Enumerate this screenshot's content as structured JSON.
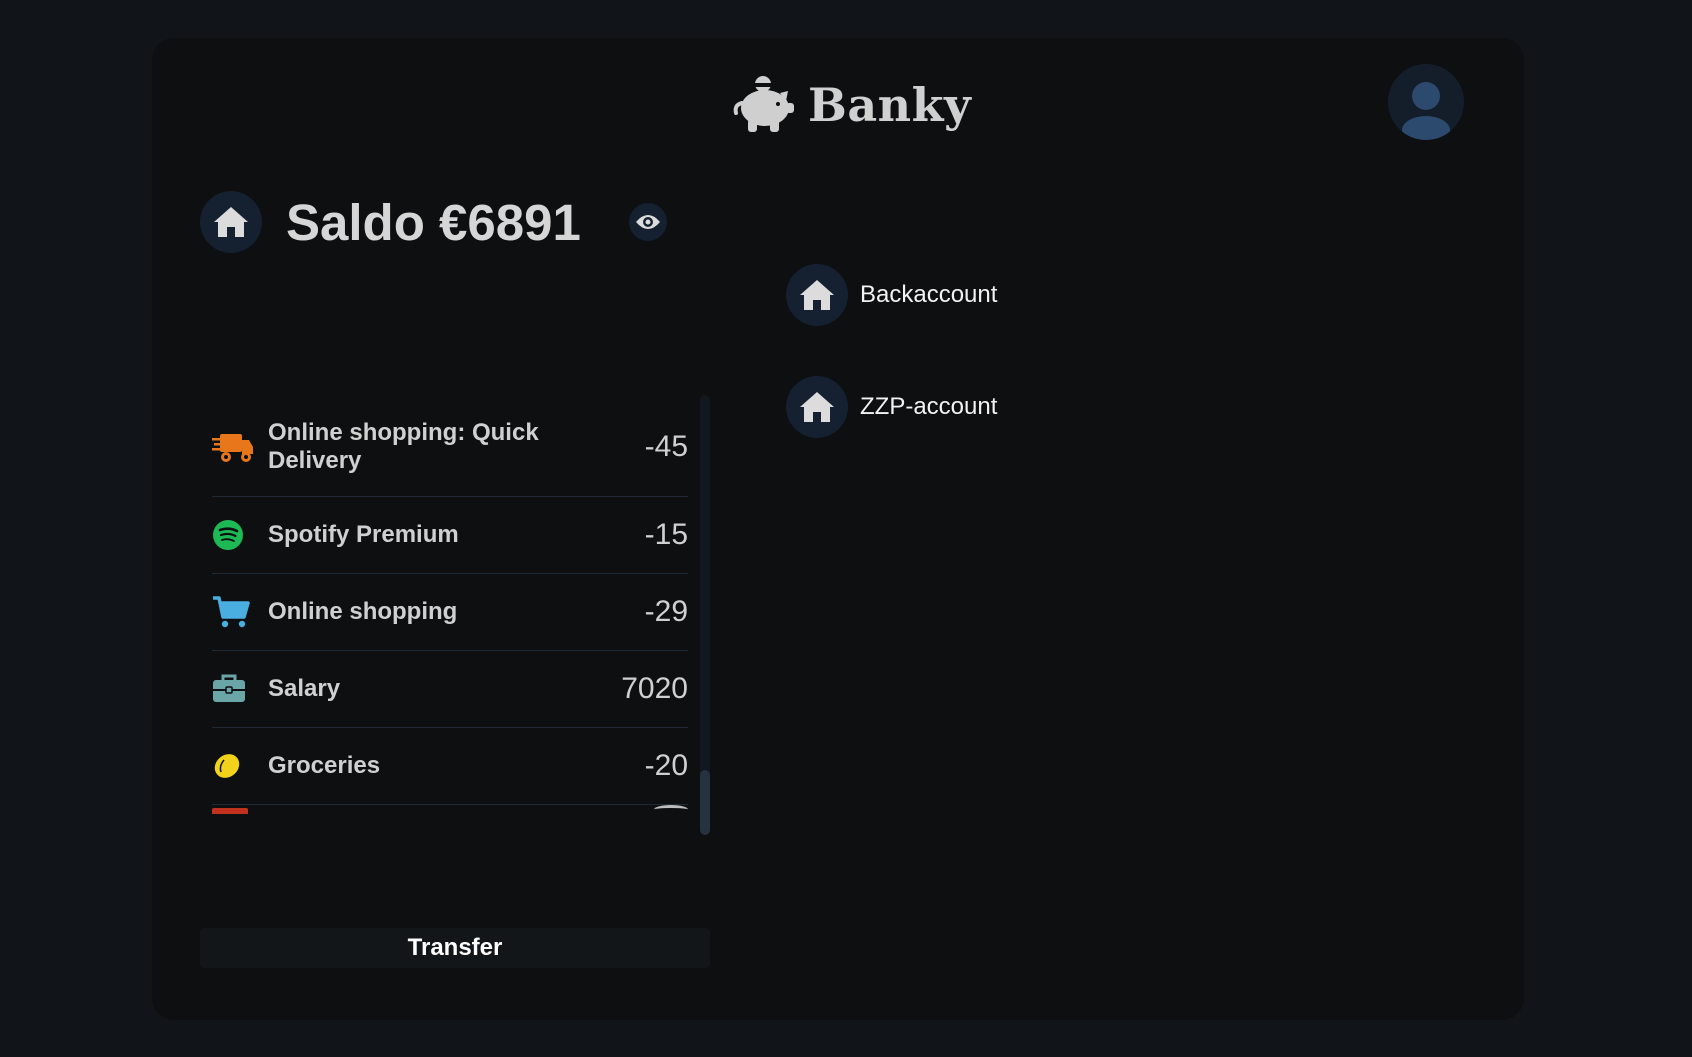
{
  "app": {
    "name": "Banky"
  },
  "balance": {
    "title": "Saldo €6891"
  },
  "transactions": [
    {
      "label": "Online shopping: Quick Delivery",
      "amount": "-45",
      "icon": "truck-fast-icon",
      "color": "#e8771b"
    },
    {
      "label": "Spotify Premium",
      "amount": "-15",
      "icon": "spotify-icon",
      "color": "#1db954"
    },
    {
      "label": "Online shopping",
      "amount": "-29",
      "icon": "cart-icon",
      "color": "#4aaee0"
    },
    {
      "label": "Salary",
      "amount": "7020",
      "icon": "briefcase-icon",
      "color": "#6aa6a8"
    },
    {
      "label": "Groceries",
      "amount": "-20",
      "icon": "lemon-icon",
      "color": "#f2d21b"
    }
  ],
  "actions": {
    "transfer_label": "Transfer"
  },
  "accounts": [
    {
      "label": "Backaccount",
      "icon": "home-icon"
    },
    {
      "label": "ZZP-account",
      "icon": "home-icon"
    }
  ],
  "colors": {
    "background": "#111419",
    "card": "#0d0f11",
    "icon_circle": "#152030",
    "avatar": "#2c4a6e"
  }
}
